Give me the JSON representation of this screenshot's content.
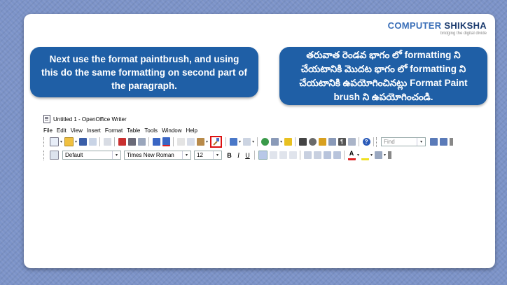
{
  "logo": {
    "text_main": "COMPUTER",
    "text_accent": "SHIKSHA",
    "tagline": "bridging the digital divide"
  },
  "left_bubble": {
    "text": "Next use the format paintbrush, and using this do the same formatting on second part of the paragraph."
  },
  "right_bubble": {
    "text": "తరువాత రెండవ భాగం లో formatting ని చేయటానికి మొదట భాగం లో formatting  ని చేయటానికి ఉపయోగించినట్లు Format Paint brush ని ఉపయోగించండి."
  },
  "window": {
    "title": "Untitled 1 - OpenOffice Writer"
  },
  "menu": [
    "File",
    "Edit",
    "View",
    "Insert",
    "Format",
    "Table",
    "Tools",
    "Window",
    "Help"
  ],
  "toolbar": {
    "find_placeholder": "Find"
  },
  "formatting": {
    "style": "Default",
    "font": "Times New Roman",
    "size": "12",
    "bold": "B",
    "italic": "I",
    "underline": "U"
  },
  "colors": {
    "bubble": "#1f5fa6",
    "highlight": "#dd1111",
    "background": "#7c93c8"
  }
}
